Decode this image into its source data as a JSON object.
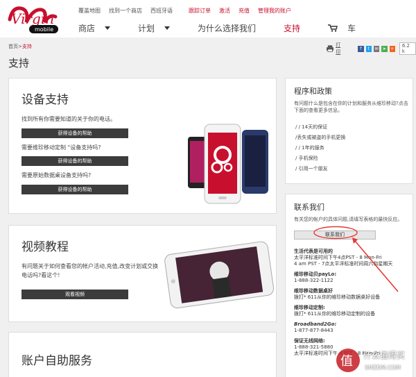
{
  "header": {
    "top_links": [
      "覆盖地图",
      "找到一个商店",
      "西班牙语"
    ],
    "top_links_red": [
      "跟踪订单",
      "激活",
      "充值",
      "管理我的账户"
    ],
    "nav": [
      {
        "label": "商店",
        "dropdown": true
      },
      {
        "label": "计划",
        "dropdown": true
      },
      {
        "label": "为什么选择我们",
        "dropdown": false
      },
      {
        "label": "支持",
        "dropdown": false,
        "active": true
      },
      {
        "label": "车",
        "dropdown": false,
        "icon": "cart-icon"
      }
    ],
    "logo_text": "Virgin mobile"
  },
  "breadcrumb": {
    "home": "首页",
    "sep": ">",
    "current": "支持"
  },
  "share": {
    "print_label": "打印",
    "count": "6.2 k"
  },
  "page_title": "支持",
  "device_support": {
    "title": "设备支持",
    "desc": "找到所有你需要知道的关于你的电话。",
    "btn1": "获得设备的帮助",
    "q2": "需要维珍移动定制 \"设备支持吗?",
    "btn2": "获得设备的帮助",
    "q3": "需要原始数据桌设备支持吗?",
    "btn3": "获得设备的帮助"
  },
  "video_tutorial": {
    "title": "视频教程",
    "desc": "有问题关于如何查看您的帐户活动,充值,改变计划或交换电话吗?看这个!",
    "btn": "观看视频"
  },
  "self_service": {
    "title": "账户自助服务"
  },
  "policies": {
    "title": "程序和政策",
    "desc": "有问题什么是包含在你的计划和服务从维珍移动?点击下面的查看更多信息。",
    "items": [
      "/ / 14天的保证",
      "/丢失或被盗的手机更换",
      "/ / 1年的服务",
      "/ 手机保险",
      "/ 引用一个朋友"
    ]
  },
  "contact": {
    "title": "联系我们",
    "desc": "有关您的帐户的具体问题,请填写表格的最快反应。",
    "btn": "联系我们",
    "hours_title": "生活代表是可用的",
    "hours_1": "太平洋标准时间下午4点PST - 8 Mon-Fri",
    "hours_2": "4 am PST - 7点太平洋标准时间周六和星期天",
    "payg_label": "维珍移动贝payLo:",
    "payg_num": "1-888-322-1122",
    "broadband_label": "维珍移动数据桌好",
    "broadband_text": "拨打* 611从你的维珍移动数据桌好设备",
    "custom_label": "维珍移动定制:",
    "custom_text": "拨打* 611从你的维珍移动定制的设备",
    "b2go_label": "Broadband2Go:",
    "b2go_num": "1-877-877-8443",
    "unlimited_label": "保证无线网络:",
    "unlimited_num": "1-888-321-5880",
    "unlimited_hours": "太平洋标准时间下午 4 PST - 8 Mon-Fri"
  },
  "watermark": {
    "text1": "什么值得买",
    "text2": "SMZDM.COM"
  },
  "colors": {
    "brand_red": "#c8102e",
    "button_dark": "#3c3c3c"
  }
}
